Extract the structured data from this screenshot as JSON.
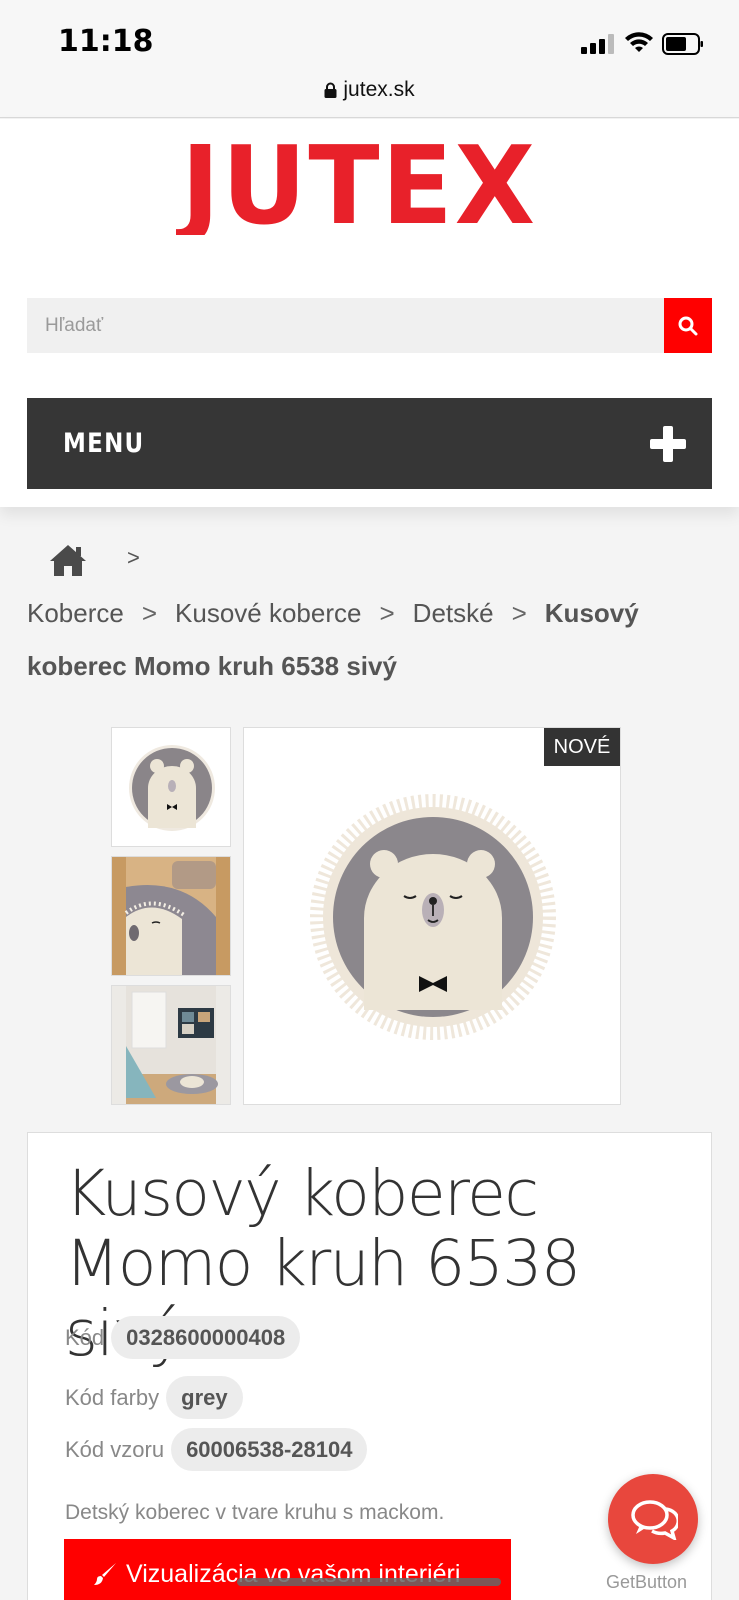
{
  "status_bar": {
    "time": "11:18",
    "url": "jutex.sk"
  },
  "header": {
    "logo_text": "JUTEX",
    "brand_color": "#e8212a",
    "search": {
      "placeholder": "Hľadať"
    },
    "menu_label": "MENU"
  },
  "breadcrumb": {
    "separator": ">",
    "items": [
      "Koberce",
      "Kusové koberce",
      "Detské"
    ],
    "current": "Kusový koberec Momo kruh 6538 sivý"
  },
  "gallery": {
    "badge": "NOVÉ",
    "thumbnail_count": 3
  },
  "product": {
    "title": "Kusový koberec Momo kruh 6538 sivý",
    "code_label": "Kód",
    "code_value": "0328600000408",
    "color_label": "Kód farby",
    "color_value": "grey",
    "pattern_label": "Kód vzoru",
    "pattern_value": "60006538-28104",
    "description": "Detský koberec v tvare kruhu s mackom.",
    "visualize_label": "Vizualizácia vo vašom interiéri"
  },
  "chat": {
    "label": "GetButton"
  },
  "colors": {
    "accent": "#ff0000",
    "menu_bg": "#363636",
    "chat": "#e8473d"
  }
}
